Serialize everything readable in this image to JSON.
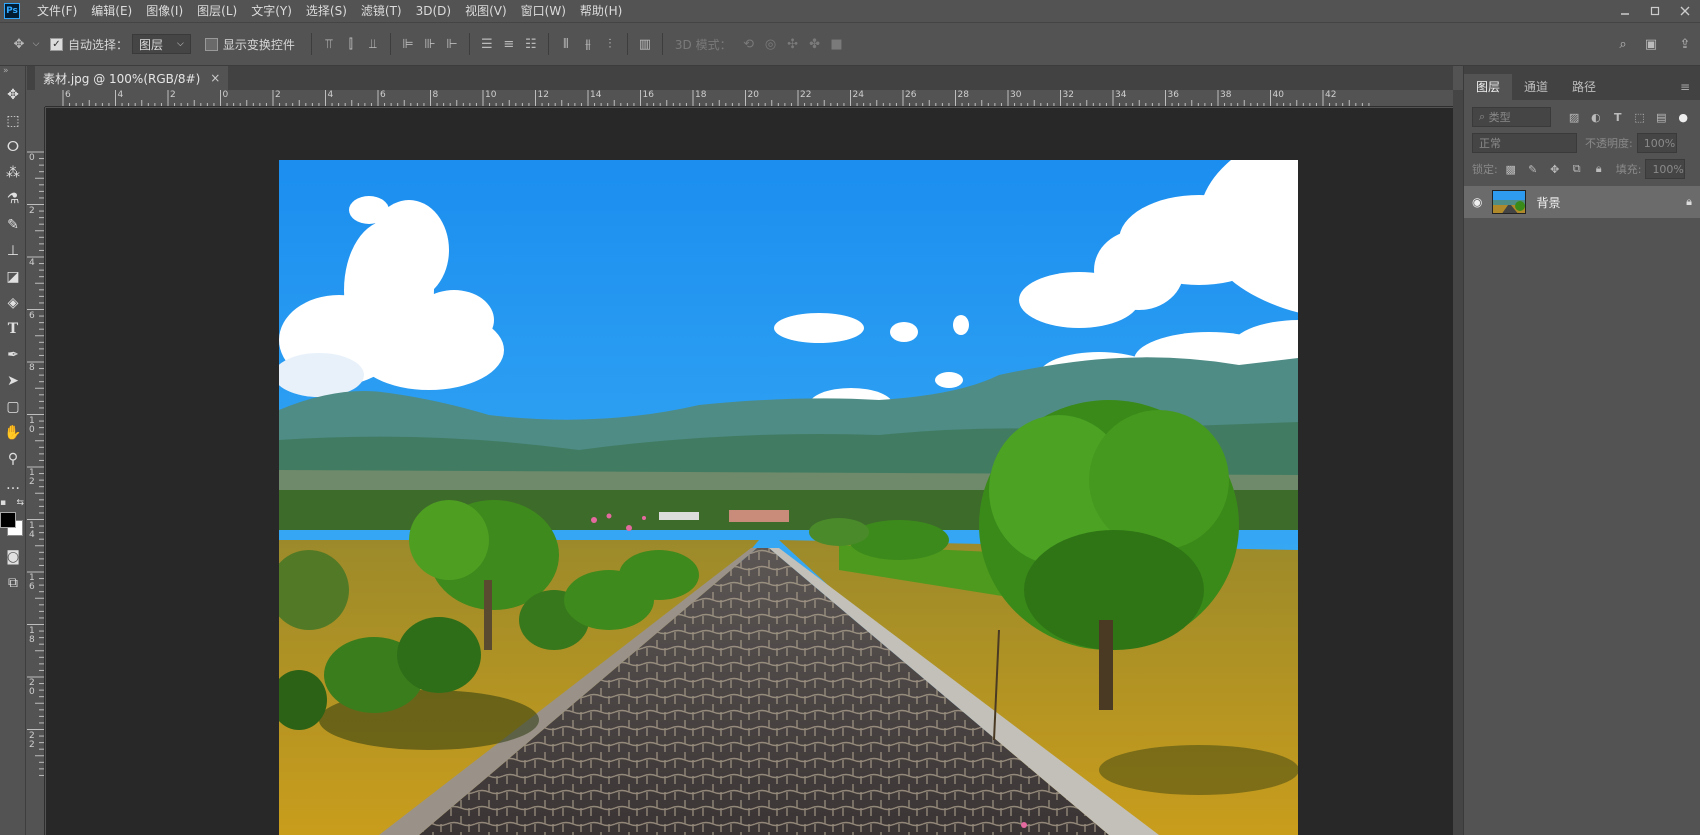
{
  "app": {
    "logo": "Ps"
  },
  "menu": [
    "文件(F)",
    "编辑(E)",
    "图像(I)",
    "图层(L)",
    "文字(Y)",
    "选择(S)",
    "滤镜(T)",
    "3D(D)",
    "视图(V)",
    "窗口(W)",
    "帮助(H)"
  ],
  "options": {
    "auto_select_label": "自动选择：",
    "auto_select_value": "图层",
    "show_transform_label": "显示变换控件",
    "mode_3d_label": "3D 模式："
  },
  "document": {
    "tab_title": "素材.jpg @ 100%(RGB/8#)",
    "close": "×"
  },
  "ruler": {
    "top": [
      "6",
      "4",
      "2",
      "0",
      "2",
      "4",
      "6",
      "8",
      "10",
      "12",
      "14",
      "16",
      "18",
      "20",
      "22",
      "24",
      "26",
      "28",
      "30",
      "32",
      "34",
      "36",
      "38",
      "40",
      "42"
    ],
    "left": [
      "0",
      "2",
      "4",
      "6",
      "8",
      "1\n0",
      "1\n2",
      "1\n4",
      "1\n6",
      "1\n8",
      "2\n0",
      "2\n2"
    ]
  },
  "panel": {
    "tabs": [
      "图层",
      "通道",
      "路径"
    ],
    "filter_placeholder": "类型",
    "blend_mode": "正常",
    "opacity_label": "不透明度:",
    "opacity_value": "100%",
    "lock_label": "锁定:",
    "fill_label": "填充:",
    "fill_value": "100%",
    "layers": [
      {
        "name": "背景",
        "visible": true,
        "locked": true
      }
    ]
  }
}
